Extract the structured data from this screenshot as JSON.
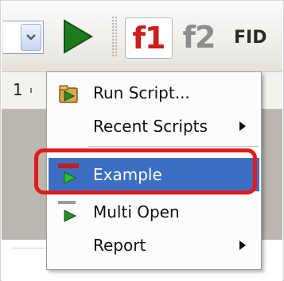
{
  "toolbar": {
    "combo_value": "",
    "f1_label": "f1",
    "f2_label": "f2",
    "fid_label": "FID",
    "icons": {
      "combo_arrow": "chevron-down-icon",
      "run": "play-icon"
    }
  },
  "ruler": {
    "number": "1"
  },
  "menu": {
    "items": [
      {
        "label": "Run Script...",
        "icon": "run-script-icon",
        "has_submenu": false
      },
      {
        "label": "Recent Scripts",
        "icon": "",
        "has_submenu": true
      },
      {
        "label": "Example",
        "icon": "script-example-icon",
        "has_submenu": false,
        "highlighted": true
      },
      {
        "label": "Multi Open",
        "icon": "script-multi-open-icon",
        "has_submenu": false
      },
      {
        "label": "Report",
        "icon": "",
        "has_submenu": true
      }
    ]
  },
  "colors": {
    "menu_highlight": "#3c6fc4",
    "annotation_ring": "#e21b1b",
    "play_green": "#1f7a1f",
    "f1_red": "#cc1d1d",
    "f2_grey": "#8d8d8d"
  }
}
